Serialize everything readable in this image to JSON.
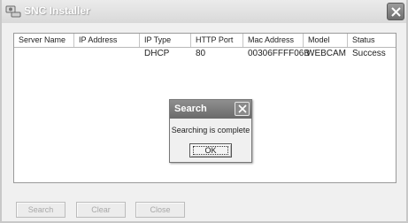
{
  "window": {
    "title": "SNC Installer",
    "icon": "installer-icon"
  },
  "table": {
    "columns": [
      "Server Name",
      "IP Address",
      "IP Type",
      "HTTP Port",
      "Mac Address",
      "Model",
      "Status"
    ],
    "rows": [
      {
        "server_name": "",
        "ip_address": "",
        "ip_type": "DHCP",
        "http_port": "80",
        "mac_address": "00306FFFF06B",
        "model": "WEBCAM",
        "status": "Success"
      }
    ]
  },
  "dialog": {
    "title": "Search",
    "message": "Searching is complete",
    "ok_label": "OK"
  },
  "buttons": {
    "search_label": "Search",
    "clear_label": "Clear",
    "close_label": "Close",
    "disabled": true
  }
}
